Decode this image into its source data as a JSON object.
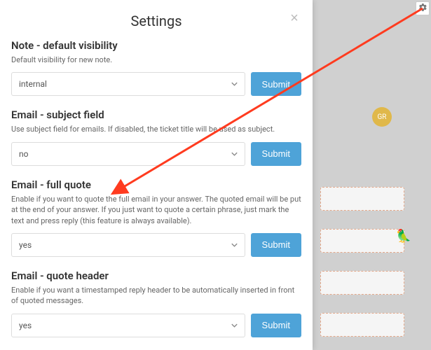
{
  "modal": {
    "title": "Settings",
    "sections": [
      {
        "title": "Note - default visibility",
        "desc": "Default visibility for new note.",
        "value": "internal",
        "submit": "Submit"
      },
      {
        "title": "Email - subject field",
        "desc": "Use subject field for emails. If disabled, the ticket title will be used as subject.",
        "value": "no",
        "submit": "Submit"
      },
      {
        "title": "Email - full quote",
        "desc": "Enable if you want to quote the full email in your answer. The quoted email will be put at the end of your answer. If you just want to quote a certain phrase, just mark the text and press reply (this feature is always available).",
        "value": "yes",
        "submit": "Submit"
      },
      {
        "title": "Email - quote header",
        "desc": "Enable if you want a timestamped reply header to be automatically inserted in front of quoted messages.",
        "value": "yes",
        "submit": "Submit"
      }
    ]
  },
  "bg": {
    "avatar": "GR"
  },
  "annotation": {
    "arrow_color": "#ff3b1f"
  }
}
